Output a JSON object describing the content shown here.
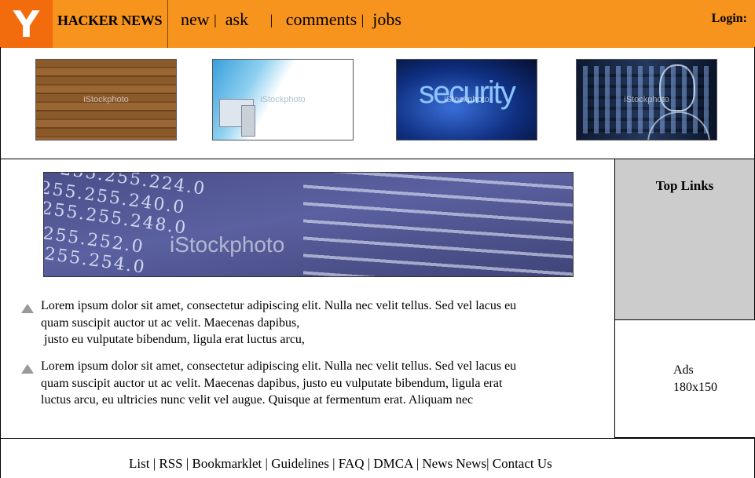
{
  "header": {
    "logo_letter": "Y",
    "site_title": "HACKER NEWS",
    "nav": [
      "new",
      "ask",
      "comments",
      "jobs"
    ],
    "nav_separator": "|",
    "login": "Login:"
  },
  "thumbnails": [
    {
      "name": "wood-texture-image",
      "watermark": "iStockphoto"
    },
    {
      "name": "computer-image",
      "watermark": "iStockphoto"
    },
    {
      "name": "security-image",
      "text": "security",
      "watermark": "iStockphoto"
    },
    {
      "name": "digital-human-image",
      "watermark": "iStockphoto"
    }
  ],
  "banner": {
    "ip_lines": [
      "255.255.224.0",
      "255.255.240.0",
      "255.255.248.0",
      "255.252.0",
      "255.254.0"
    ],
    "watermark": "iStockphoto"
  },
  "stories": [
    {
      "line1": "Lorem ipsum dolor sit amet, consectetur adipiscing elit. Nulla nec velit tellus. Sed vel lacus eu",
      "line2": "quam suscipit auctor ut ac velit. Maecenas dapibus,",
      "line3": " justo eu vulputate bibendum, ligula erat luctus arcu,"
    },
    {
      "line1": "Lorem ipsum dolor sit amet, consectetur adipiscing elit. Nulla nec velit tellus. Sed vel lacus eu",
      "line2": "quam suscipit auctor ut ac velit. Maecenas dapibus, justo eu vulputate bibendum, ligula erat",
      "line3": "luctus arcu, eu ultricies nunc velit vel augue. Quisque at fermentum erat. Aliquam nec"
    }
  ],
  "sidebar": {
    "top_links_title": "Top Links",
    "ads_line1": "Ads",
    "ads_line2": "180x150"
  },
  "footer": {
    "links": [
      "List",
      "RSS",
      "Bookmarklet",
      "Guidelines",
      "FAQ",
      "DMCA",
      "News News",
      "Contact Us"
    ],
    "separator": "|"
  },
  "colors": {
    "header_bg": "#f7941d",
    "logo_bg": "#f26c0d",
    "sidebar_gray": "#cccccc"
  }
}
